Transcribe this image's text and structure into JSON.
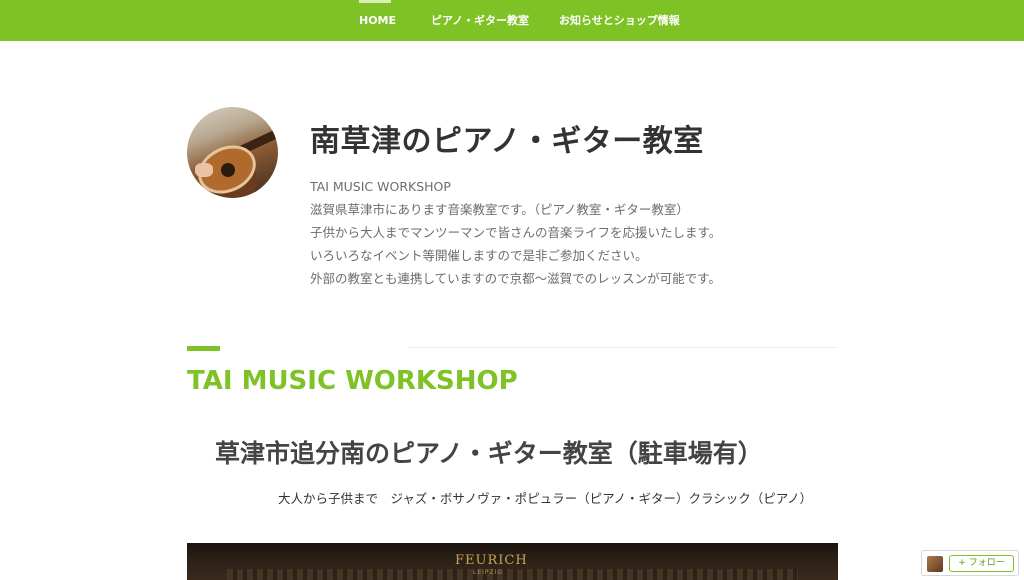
{
  "nav": {
    "home": "HOME",
    "piano_guitar": "ピアノ・ギター教室",
    "news_shop": "お知らせとショップ情報"
  },
  "header": {
    "site_title": "南草津のピアノ・ギター教室",
    "description": [
      "TAI MUSIC WORKSHOP",
      "滋賀県草津市にあります音楽教室です。（ピアノ教室・ギター教室）",
      "子供から大人までマンツーマンで皆さんの音楽ライフを応援いたします。",
      "いろいろなイベント等開催しますので是非ご参加ください。",
      "外部の教室とも連携していますので京都～滋賀でのレッスンが可能です。"
    ]
  },
  "main": {
    "section_title": "TAI MUSIC WORKSHOP",
    "subheading": "草津市追分南のピアノ・ギター教室（駐車場有）",
    "genres": "大人から子供まで　ジャズ・ボサノヴァ・ポピュラー（ピアノ・ギター）クラシック（ピアノ）",
    "hero_brand": "FEURICH",
    "hero_brand_sub": "LEIPZIG"
  },
  "follow": {
    "label": "+ フォロー"
  },
  "colors": {
    "accent": "#7ec225",
    "title": "#333333",
    "muted": "#6d6d6d"
  }
}
